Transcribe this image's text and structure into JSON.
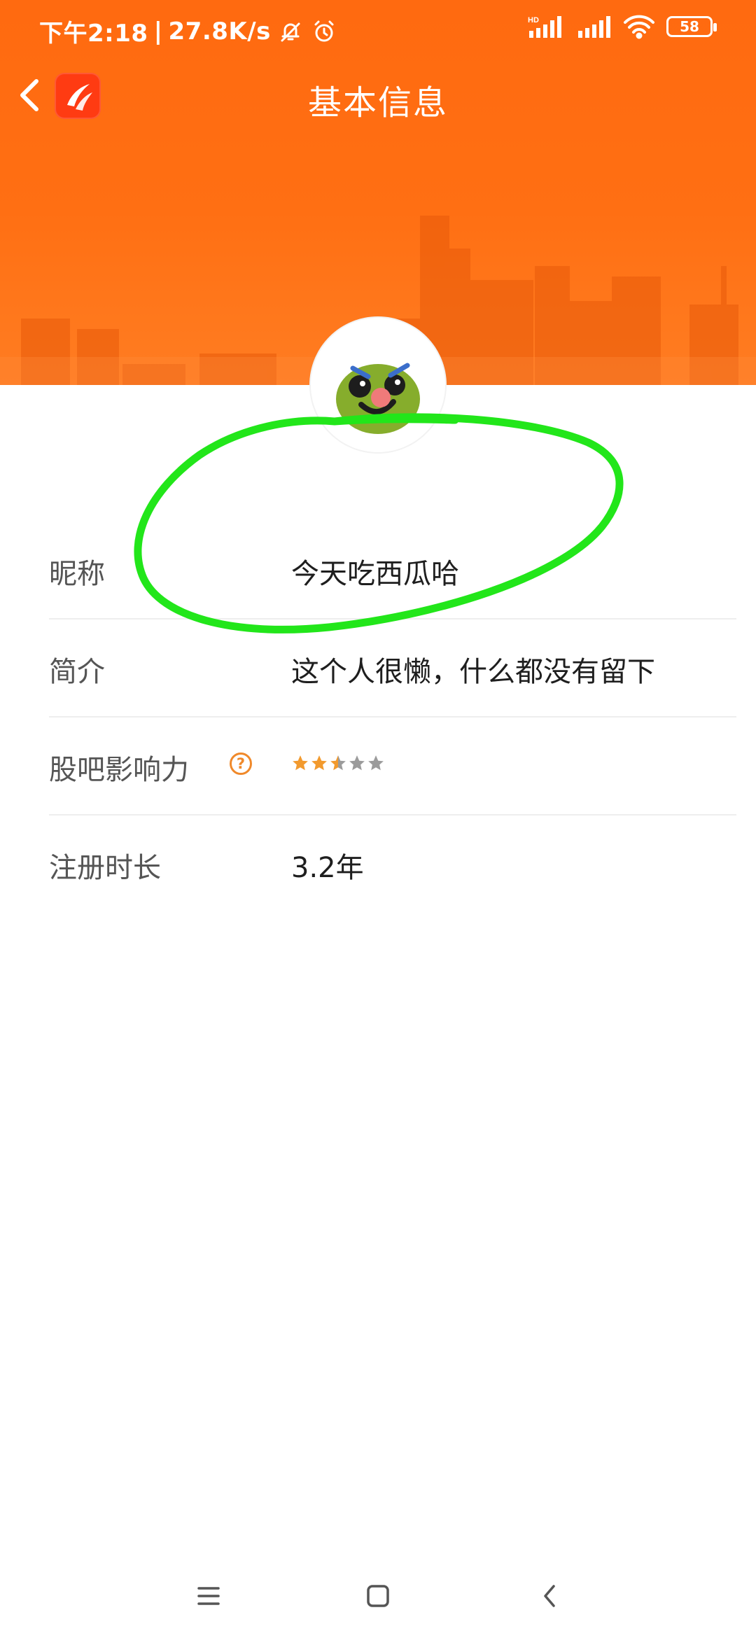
{
  "status_bar": {
    "time": "下午2:18",
    "speed": "27.8K/s",
    "battery": "58",
    "hd_label": "HD"
  },
  "header": {
    "title": "基本信息",
    "theme_color": "#ff6a10"
  },
  "profile": {
    "rows": [
      {
        "label": "昵称",
        "value": "今天吃西瓜哈"
      },
      {
        "label": "简介",
        "value": "这个人很懒，什么都没有留下"
      },
      {
        "label": "股吧影响力",
        "help": "?",
        "stars_filled": 2.5,
        "stars_total": 5
      },
      {
        "label": "注册时长",
        "value": "3.2年"
      }
    ]
  },
  "annotation": {
    "color": "#22e61a",
    "shape": "hand-drawn-ellipse"
  },
  "nav": {
    "icons": [
      "menu-icon",
      "home-icon",
      "back-icon"
    ]
  }
}
